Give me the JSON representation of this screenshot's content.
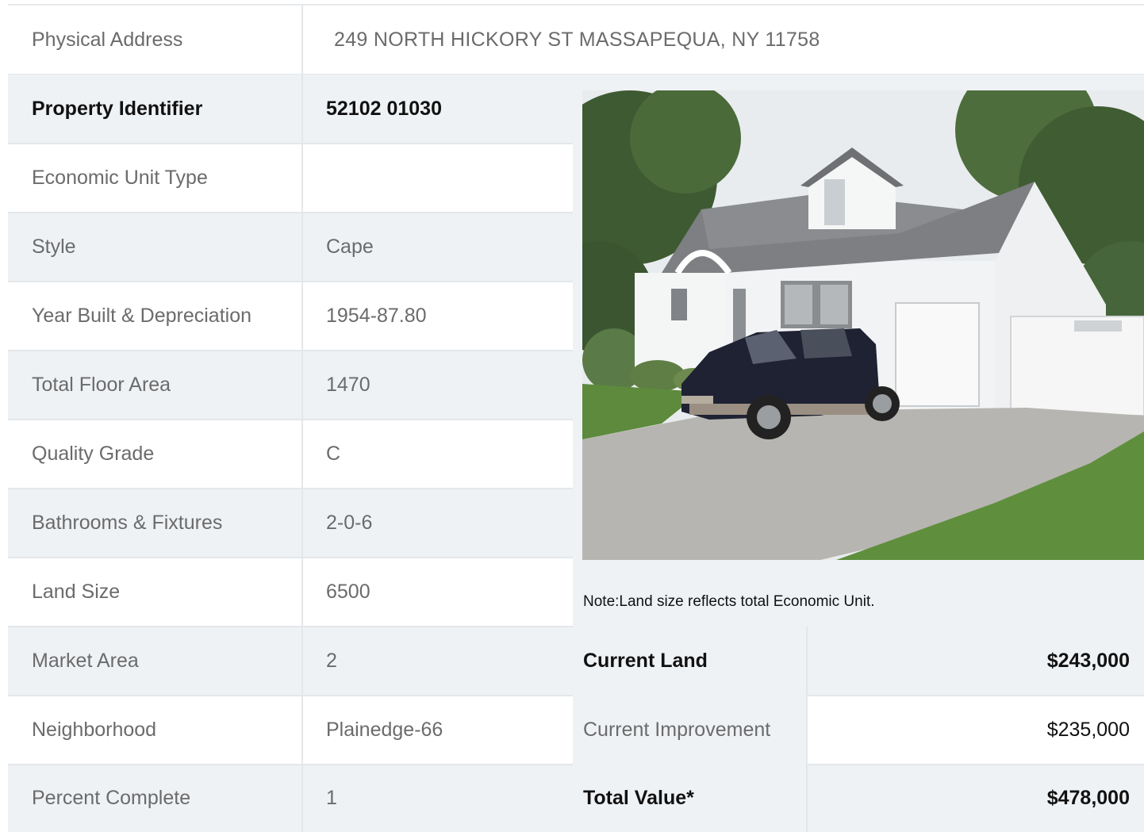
{
  "address": {
    "label": "Physical Address",
    "value": "249  NORTH HICKORY ST  MASSAPEQUA, NY  11758"
  },
  "property_rows": [
    {
      "label": "Property Identifier",
      "value": "52102  01030"
    },
    {
      "label": "Economic Unit Type",
      "value": ""
    },
    {
      "label": "Style",
      "value": "Cape"
    },
    {
      "label": "Year Built & Depreciation",
      "value": "1954-87.80"
    },
    {
      "label": "Total Floor Area",
      "value": "1470"
    },
    {
      "label": "Quality Grade",
      "value": "C"
    },
    {
      "label": "Bathrooms & Fixtures",
      "value": "2-0-6"
    },
    {
      "label": "Land Size",
      "value": "6500"
    },
    {
      "label": "Market Area",
      "value": "2"
    },
    {
      "label": "Neighborhood",
      "value": "Plainedge-66"
    },
    {
      "label": "Percent Complete",
      "value": "1"
    }
  ],
  "note": "Note:Land size reflects total Economic Unit.",
  "valuation": [
    {
      "label": "Current Land",
      "value": "$243,000"
    },
    {
      "label": "Current Improvement",
      "value": "$235,000"
    },
    {
      "label": "Total Value*",
      "value": "$478,000"
    }
  ],
  "colors": {
    "row_shade": "#eff2f5",
    "border": "#e4e7ea",
    "text_muted": "#6b6b6b",
    "text_strong": "#111111"
  }
}
